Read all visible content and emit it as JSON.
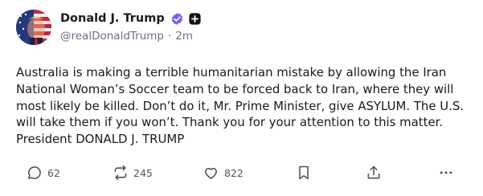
{
  "post": {
    "author": {
      "display_name": "Donald J. Trump",
      "handle": "@realDonaldTrump",
      "separator": "·",
      "time": "2m",
      "avatar_icon": "avatar-flag-portrait",
      "verified_icon": "verified-badge-icon",
      "verified_color": "#7c5cf2",
      "follow_icon": "plus-badge-icon"
    },
    "text": "Australia is making a terrible humanitarian mistake by allowing the Iran National Woman’s Soccer team to be forced back to Iran, where they will most likely be killed. Don’t do it, Mr. Prime Minister, give ASYLUM. The U.S. will take them if you won’t. Thank you for your attention to this matter. President DONALD J. TRUMP",
    "actions": {
      "replies": "62",
      "retruths": "245",
      "likes": "822"
    }
  }
}
